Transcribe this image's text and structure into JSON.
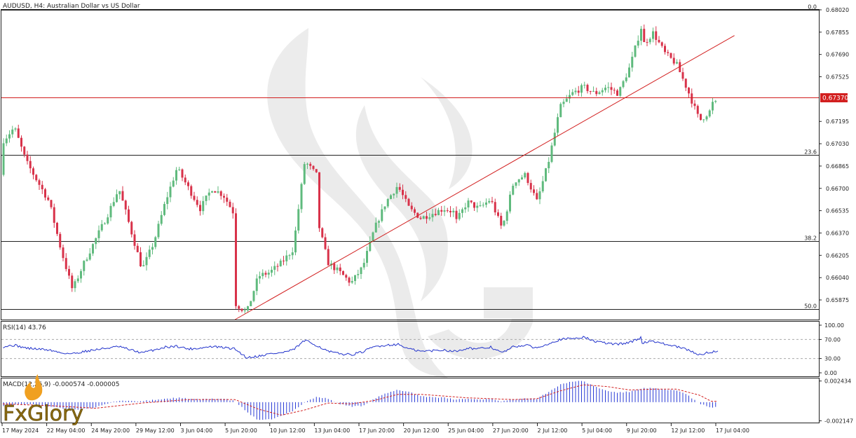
{
  "header": {
    "symbol_text": "AUDUSD, H4:  Australian Dollar vs US Dollar",
    "rsi_label": "RSI(14) 43.76",
    "macd_label": "MACD(12,26,9) -0.000574 -0.000005"
  },
  "logo": {
    "text": "FxGlory"
  },
  "colors": {
    "bull": "#5fba7d",
    "bear": "#d8324a",
    "red_line": "#d21f1f",
    "rsi_line": "#2233cc",
    "macd_bar": "#2b3cd6",
    "signal": "#d21f1f",
    "grid": "#e6e6e6",
    "text": "#222222",
    "frame": "#222222"
  },
  "chart_data": [
    {
      "type": "candlestick",
      "title": "AUDUSD, H4:  Australian Dollar vs US Dollar",
      "ylim": [
        0.6573,
        0.6802
      ],
      "y_ticks": [
        "0.68020",
        "0.67855",
        "0.67690",
        "0.67525",
        "0.67195",
        "0.67030",
        "0.66865",
        "0.66700",
        "0.66535",
        "0.66370",
        "0.66205",
        "0.66040",
        "0.65875"
      ],
      "x_ticks": [
        "17 May 2024",
        "22 May 04:00",
        "24 May 20:00",
        "29 May 12:00",
        "3 Jun 04:00",
        "5 Jun 20:00",
        "10 Jun 12:00",
        "13 Jun 04:00",
        "17 Jun 20:00",
        "20 Jun 12:00",
        "25 Jun 04:00",
        "27 Jun 20:00",
        "2 Jul 12:00",
        "5 Jul 04:00",
        "9 Jul 20:00",
        "12 Jul 12:00",
        "17 Jul 04:00"
      ],
      "current_price": {
        "label": "0.67370",
        "value": 0.6737
      },
      "fibonacci_levels": [
        {
          "label": "0.0",
          "value": 0.6802
        },
        {
          "label": "23.6",
          "value": 0.6695
        },
        {
          "label": "38.2",
          "value": 0.6631
        },
        {
          "label": "50.0",
          "value": 0.6581
        }
      ],
      "trendline": {
        "from": {
          "x": "6 Jun 2024",
          "y": 0.6573
        },
        "to": {
          "x": "19 Jul 2024",
          "y": 0.6783
        }
      },
      "anchors": [
        [
          "17 May 2024",
          0.668
        ],
        [
          "17 May 2024",
          0.6705
        ],
        [
          "18 May 2024",
          0.6715
        ],
        [
          "19 May 2024",
          0.669
        ],
        [
          "21 May 2024",
          0.666
        ],
        [
          "22 May 2024",
          0.6625
        ],
        [
          "23 May 2024",
          0.6595
        ],
        [
          "24 May 2024",
          0.6615
        ],
        [
          "26 May 2024",
          0.665
        ],
        [
          "27 May 2024",
          0.667
        ],
        [
          "28 May 2024",
          0.664
        ],
        [
          "29 May 2024",
          0.661
        ],
        [
          "30 May 2024",
          0.663
        ],
        [
          "31 May 2024",
          0.666
        ],
        [
          "1 Jun 2024",
          0.6685
        ],
        [
          "2 Jun 2024",
          0.667
        ],
        [
          "3 Jun 2024",
          0.6655
        ],
        [
          "4 Jun 2024",
          0.667
        ],
        [
          "5 Jun 2024",
          0.6665
        ],
        [
          "6 Jun 2024",
          0.665
        ],
        [
          "6 Jun 2024",
          0.6585
        ],
        [
          "7 Jun 2024",
          0.6578
        ],
        [
          "8 Jun 2024",
          0.6605
        ],
        [
          "9 Jun 2024",
          0.6608
        ],
        [
          "10 Jun 2024",
          0.6615
        ],
        [
          "11 Jun 2024",
          0.6625
        ],
        [
          "12 Jun 2024",
          0.669
        ],
        [
          "13 Jun 2024",
          0.668
        ],
        [
          "13 Jun 2024",
          0.665
        ],
        [
          "14 Jun 2024",
          0.6615
        ],
        [
          "15 Jun 2024",
          0.6608
        ],
        [
          "16 Jun 2024",
          0.66
        ],
        [
          "17 Jun 2024",
          0.6612
        ],
        [
          "18 Jun 2024",
          0.664
        ],
        [
          "19 Jun 2024",
          0.666
        ],
        [
          "20 Jun 2024",
          0.6672
        ],
        [
          "21 Jun 2024",
          0.6655
        ],
        [
          "22 Jun 2024",
          0.6648
        ],
        [
          "24 Jun 2024",
          0.6655
        ],
        [
          "25 Jun 2024",
          0.6652
        ],
        [
          "25 Jun 2024",
          0.6645
        ],
        [
          "26 Jun 2024",
          0.666
        ],
        [
          "27 Jun 2024",
          0.6655
        ],
        [
          "28 Jun 2024",
          0.6662
        ],
        [
          "29 Jun 2024",
          0.664
        ],
        [
          "30 Jun 2024",
          0.6675
        ],
        [
          "1 Jul 2024",
          0.668
        ],
        [
          "2 Jul 2024",
          0.666
        ],
        [
          "3 Jul 2024",
          0.669
        ],
        [
          "4 Jul 2024",
          0.673
        ],
        [
          "5 Jul 2024",
          0.674
        ],
        [
          "6 Jul 2024",
          0.6745
        ],
        [
          "7 Jul 2024",
          0.674
        ],
        [
          "8 Jul 2024",
          0.6745
        ],
        [
          "9 Jul 2024",
          0.674
        ],
        [
          "10 Jul 2024",
          0.676
        ],
        [
          "11 Jul 2024",
          0.679
        ],
        [
          "11 Jul 2024",
          0.6775
        ],
        [
          "12 Jul 2024",
          0.6785
        ],
        [
          "13 Jul 2024",
          0.677
        ],
        [
          "14 Jul 2024",
          0.6762
        ],
        [
          "15 Jul 2024",
          0.6742
        ],
        [
          "16 Jul 2024",
          0.672
        ],
        [
          "17 Jul 2024",
          0.6728
        ],
        [
          "17 Jul 2024",
          0.6733
        ]
      ]
    },
    {
      "type": "line",
      "title": "RSI(14) 43.76",
      "ylim": [
        0,
        100
      ],
      "y_ticks": [
        "100.00",
        "70.00",
        "30.00",
        "0.00"
      ],
      "levels": [
        70,
        30
      ],
      "anchors": [
        [
          "17 May 2024",
          55
        ],
        [
          "18 May 2024",
          58
        ],
        [
          "19 May 2024",
          52
        ],
        [
          "21 May 2024",
          48
        ],
        [
          "22 May 2024",
          42
        ],
        [
          "23 May 2024",
          40
        ],
        [
          "24 May 2024",
          45
        ],
        [
          "26 May 2024",
          52
        ],
        [
          "27 May 2024",
          55
        ],
        [
          "28 May 2024",
          48
        ],
        [
          "29 May 2024",
          42
        ],
        [
          "30 May 2024",
          48
        ],
        [
          "31 May 2024",
          54
        ],
        [
          "1 Jun 2024",
          56
        ],
        [
          "2 Jun 2024",
          50
        ],
        [
          "3 Jun 2024",
          52
        ],
        [
          "4 Jun 2024",
          55
        ],
        [
          "5 Jun 2024",
          53
        ],
        [
          "6 Jun 2024",
          50
        ],
        [
          "7 Jun 2024",
          32
        ],
        [
          "8 Jun 2024",
          35
        ],
        [
          "9 Jun 2024",
          40
        ],
        [
          "10 Jun 2024",
          42
        ],
        [
          "11 Jun 2024",
          48
        ],
        [
          "12 Jun 2024",
          68
        ],
        [
          "13 Jun 2024",
          58
        ],
        [
          "14 Jun 2024",
          45
        ],
        [
          "15 Jun 2024",
          40
        ],
        [
          "16 Jun 2024",
          38
        ],
        [
          "17 Jun 2024",
          44
        ],
        [
          "18 Jun 2024",
          55
        ],
        [
          "19 Jun 2024",
          58
        ],
        [
          "20 Jun 2024",
          60
        ],
        [
          "21 Jun 2024",
          50
        ],
        [
          "22 Jun 2024",
          45
        ],
        [
          "24 Jun 2024",
          48
        ],
        [
          "25 Jun 2024",
          45
        ],
        [
          "26 Jun 2024",
          52
        ],
        [
          "27 Jun 2024",
          50
        ],
        [
          "28 Jun 2024",
          54
        ],
        [
          "29 Jun 2024",
          42
        ],
        [
          "30 Jun 2024",
          55
        ],
        [
          "1 Jul 2024",
          58
        ],
        [
          "2 Jul 2024",
          52
        ],
        [
          "3 Jul 2024",
          62
        ],
        [
          "4 Jul 2024",
          70
        ],
        [
          "5 Jul 2024",
          72
        ],
        [
          "6 Jul 2024",
          75
        ],
        [
          "7 Jul 2024",
          66
        ],
        [
          "8 Jul 2024",
          62
        ],
        [
          "9 Jul 2024",
          60
        ],
        [
          "10 Jul 2024",
          64
        ],
        [
          "11 Jul 2024",
          74
        ],
        [
          "11 Jul 2024",
          63
        ],
        [
          "12 Jul 2024",
          67
        ],
        [
          "13 Jul 2024",
          60
        ],
        [
          "14 Jul 2024",
          55
        ],
        [
          "15 Jul 2024",
          48
        ],
        [
          "16 Jul 2024",
          38
        ],
        [
          "17 Jul 2024",
          44
        ],
        [
          "17 Jul 2024",
          44
        ]
      ]
    },
    {
      "type": "bar",
      "title": "MACD(12,26,9) -0.000574 -0.000005",
      "ylim": [
        -0.00235,
        0.00265
      ],
      "y_ticks": [
        "0.002434",
        "-0.002147"
      ],
      "histogram_anchors": [
        [
          "17 May 2024",
          -0.0004
        ],
        [
          "19 May 2024",
          -0.0002
        ],
        [
          "21 May 2024",
          -0.0005
        ],
        [
          "23 May 2024",
          -0.0009
        ],
        [
          "25 May 2024",
          -0.0006
        ],
        [
          "27 May 2024",
          0.0002
        ],
        [
          "29 May 2024",
          0.0001
        ],
        [
          "31 May 2024",
          0.0004
        ],
        [
          "1 Jun 2024",
          0.0005
        ],
        [
          "3 Jun 2024",
          0.0003
        ],
        [
          "4 Jun 2024",
          0.0004
        ],
        [
          "5 Jun 2024",
          0.0004
        ],
        [
          "6 Jun 2024",
          0.0001
        ],
        [
          "7 Jun 2024",
          -0.0011
        ],
        [
          "8 Jun 2024",
          -0.0021
        ],
        [
          "9 Jun 2024",
          -0.002
        ],
        [
          "10 Jun 2024",
          -0.0016
        ],
        [
          "11 Jun 2024",
          -0.001
        ],
        [
          "12 Jun 2024",
          0.0
        ],
        [
          "13 Jun 2024",
          0.0006
        ],
        [
          "14 Jun 2024",
          0.0004
        ],
        [
          "15 Jun 2024",
          -0.0002
        ],
        [
          "16 Jun 2024",
          -0.0005
        ],
        [
          "17 Jun 2024",
          -0.0004
        ],
        [
          "18 Jun 2024",
          0.0004
        ],
        [
          "19 Jun 2024",
          0.001
        ],
        [
          "20 Jun 2024",
          0.0014
        ],
        [
          "21 Jun 2024",
          0.0012
        ],
        [
          "22 Jun 2024",
          0.0007
        ],
        [
          "24 Jun 2024",
          0.0005
        ],
        [
          "25 Jun 2024",
          0.0003
        ],
        [
          "26 Jun 2024",
          0.0004
        ],
        [
          "27 Jun 2024",
          0.0003
        ],
        [
          "28 Jun 2024",
          0.0004
        ],
        [
          "29 Jun 2024",
          0.0001
        ],
        [
          "30 Jun 2024",
          0.0003
        ],
        [
          "1 Jul 2024",
          0.0005
        ],
        [
          "2 Jul 2024",
          0.0004
        ],
        [
          "3 Jul 2024",
          0.0012
        ],
        [
          "4 Jul 2024",
          0.002
        ],
        [
          "5 Jul 2024",
          0.0024
        ],
        [
          "6 Jul 2024",
          0.0024
        ],
        [
          "7 Jul 2024",
          0.0018
        ],
        [
          "8 Jul 2024",
          0.0013
        ],
        [
          "9 Jul 2024",
          0.0011
        ],
        [
          "10 Jul 2024",
          0.0012
        ],
        [
          "11 Jul 2024",
          0.0016
        ],
        [
          "12 Jul 2024",
          0.0016
        ],
        [
          "13 Jul 2024",
          0.0014
        ],
        [
          "14 Jul 2024",
          0.0014
        ],
        [
          "15 Jul 2024",
          0.0008
        ],
        [
          "16 Jul 2024",
          -0.0002
        ],
        [
          "17 Jul 2024",
          -0.0006
        ],
        [
          "17 Jul 2024",
          -0.0006
        ]
      ],
      "signal_anchors": [
        [
          "17 May 2024",
          -0.0002
        ],
        [
          "21 May 2024",
          -0.0004
        ],
        [
          "25 May 2024",
          -0.0007
        ],
        [
          "29 May 2024",
          -0.0001
        ],
        [
          "2 Jun 2024",
          0.0003
        ],
        [
          "6 Jun 2024",
          0.0003
        ],
        [
          "8 Jun 2024",
          -0.0008
        ],
        [
          "10 Jun 2024",
          -0.0015
        ],
        [
          "12 Jun 2024",
          -0.0009
        ],
        [
          "14 Jun 2024",
          -0.0001
        ],
        [
          "16 Jun 2024",
          -0.0002
        ],
        [
          "18 Jun 2024",
          0.0002
        ],
        [
          "20 Jun 2024",
          0.0009
        ],
        [
          "22 Jun 2024",
          0.0009
        ],
        [
          "26 Jun 2024",
          0.0005
        ],
        [
          "30 Jun 2024",
          0.0003
        ],
        [
          "2 Jul 2024",
          0.0004
        ],
        [
          "4 Jul 2024",
          0.0013
        ],
        [
          "6 Jul 2024",
          0.002
        ],
        [
          "8 Jul 2024",
          0.0018
        ],
        [
          "10 Jul 2024",
          0.0014
        ],
        [
          "12 Jul 2024",
          0.0015
        ],
        [
          "14 Jul 2024",
          0.0015
        ],
        [
          "16 Jul 2024",
          0.0008
        ],
        [
          "17 Jul 2024",
          0.0001
        ]
      ]
    }
  ]
}
